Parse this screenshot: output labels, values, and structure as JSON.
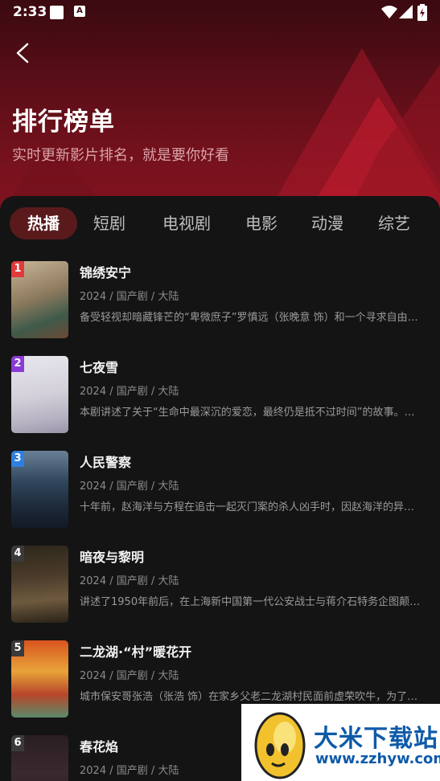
{
  "status_bar": {
    "time": "2:33",
    "a_badge": "A"
  },
  "header": {
    "title": "排行榜单",
    "subtitle": "实时更新影片排名，就是要你好看"
  },
  "tabs": [
    {
      "label": "热播",
      "active": true
    },
    {
      "label": "短剧",
      "active": false
    },
    {
      "label": "电视剧",
      "active": false
    },
    {
      "label": "电影",
      "active": false
    },
    {
      "label": "动漫",
      "active": false
    },
    {
      "label": "综艺",
      "active": false
    }
  ],
  "items": [
    {
      "rank": "1",
      "rank_color": "#e03a3a",
      "title": "锦绣安宁",
      "meta": "2024 / 国产剧 / 大陆",
      "desc": "备受轻视却暗藏锋芒的“卑微庶子”罗慎远（张晚意 饰）和一个寻求自由…"
    },
    {
      "rank": "2",
      "rank_color": "#8a3ad6",
      "title": "七夜雪",
      "meta": "2024 / 国产剧 / 大陆",
      "desc": "本剧讲述了关于“生命中最深沉的爱恋，最终仍是抵不过时间”的故事。…"
    },
    {
      "rank": "3",
      "rank_color": "#2f7fe0",
      "title": "人民警察",
      "meta": "2024 / 国产剧 / 大陆",
      "desc": "十年前，赵海洋与方程在追击一起灭门案的杀人凶手时，因赵海洋的异…"
    },
    {
      "rank": "4",
      "rank_color": "#3a3a3a",
      "title": "暗夜与黎明",
      "meta": "2024 / 国产剧 / 大陆",
      "desc": "讲述了1950年前后，在上海新中国第一代公安战士与蒋介石特务企图颠…"
    },
    {
      "rank": "5",
      "rank_color": "#3a3a3a",
      "title": "二龙湖·“村”暖花开",
      "meta": "2024 / 国产剧 / 大陆",
      "desc": "城市保安哥张浩（张浩 饰）在家乡父老二龙湖村民面前虚荣吹牛，为了…"
    },
    {
      "rank": "6",
      "rank_color": "#3a3a3a",
      "title": "春花焰",
      "meta": "2024 / 国产剧 / 大陆",
      "desc": ""
    }
  ],
  "watermark": {
    "name": "大米下载站",
    "url": "www.zzhyw.com"
  }
}
